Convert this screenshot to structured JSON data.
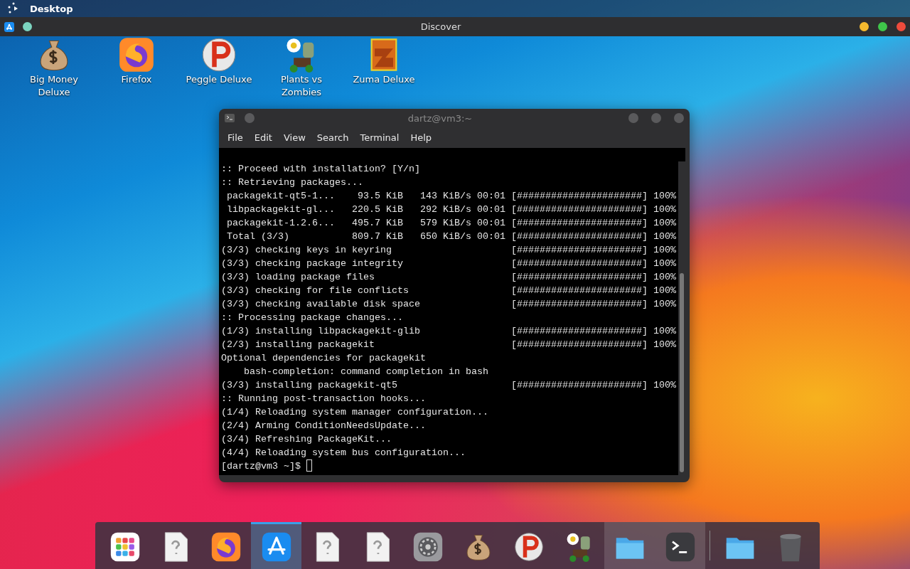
{
  "top_bar": {
    "title": "Desktop"
  },
  "app_bar": {
    "title": "Discover",
    "controls": [
      {
        "kind": "minimize"
      },
      {
        "kind": "maximize"
      },
      {
        "kind": "close"
      }
    ]
  },
  "desktop_icons": [
    {
      "kind": "money",
      "label": "Big Money Deluxe"
    },
    {
      "kind": "firefox",
      "label": "Firefox"
    },
    {
      "kind": "peggle",
      "label": "Peggle Deluxe"
    },
    {
      "kind": "plants",
      "label": "Plants vs Zombies"
    },
    {
      "kind": "zuma",
      "label": "Zuma Deluxe"
    }
  ],
  "terminal": {
    "title": "dartz@vm3:~",
    "menu": [
      "File",
      "Edit",
      "View",
      "Search",
      "Terminal",
      "Help"
    ],
    "lines": [
      {
        "text": ":: Proceed with installation? [Y/n]"
      },
      {
        "text": ":: Retrieving packages..."
      },
      {
        "text": " packagekit-qt5-1...    93.5 KiB   143 KiB/s 00:01",
        "bar": "[######################]",
        "percent": "100%"
      },
      {
        "text": " libpackagekit-gl...   220.5 KiB   292 KiB/s 00:01",
        "bar": "[######################]",
        "percent": "100%"
      },
      {
        "text": " packagekit-1.2.6...   495.7 KiB   579 KiB/s 00:01",
        "bar": "[######################]",
        "percent": "100%"
      },
      {
        "text": " Total (3/3)           809.7 KiB   650 KiB/s 00:01",
        "bar": "[######################]",
        "percent": "100%"
      },
      {
        "text": "(3/3) checking keys in keyring",
        "bar": "[######################]",
        "percent": "100%"
      },
      {
        "text": "(3/3) checking package integrity",
        "bar": "[######################]",
        "percent": "100%"
      },
      {
        "text": "(3/3) loading package files",
        "bar": "[######################]",
        "percent": "100%"
      },
      {
        "text": "(3/3) checking for file conflicts",
        "bar": "[######################]",
        "percent": "100%"
      },
      {
        "text": "(3/3) checking available disk space",
        "bar": "[######################]",
        "percent": "100%"
      },
      {
        "text": ":: Processing package changes..."
      },
      {
        "text": "(1/3) installing libpackagekit-glib",
        "bar": "[######################]",
        "percent": "100%"
      },
      {
        "text": "(2/3) installing packagekit",
        "bar": "[######################]",
        "percent": "100%"
      },
      {
        "text": "Optional dependencies for packagekit"
      },
      {
        "text": "    bash-completion: command completion in bash"
      },
      {
        "text": "(3/3) installing packagekit-qt5",
        "bar": "[######################]",
        "percent": "100%"
      },
      {
        "text": ":: Running post-transaction hooks..."
      },
      {
        "text": "(1/4) Reloading system manager configuration..."
      },
      {
        "text": "(2/4) Arming ConditionNeedsUpdate..."
      },
      {
        "text": "(3/4) Refreshing PackageKit..."
      },
      {
        "text": "(4/4) Reloading system bus configuration..."
      }
    ],
    "prompt": "[dartz@vm3 ~]$"
  },
  "dock": {
    "apps": [
      {
        "kind": "apps",
        "selected": false,
        "open": false
      },
      {
        "kind": "unknown",
        "selected": false,
        "open": false
      },
      {
        "kind": "firefox",
        "selected": false,
        "open": false
      },
      {
        "kind": "store",
        "selected": true,
        "open": true
      },
      {
        "kind": "unknown",
        "selected": false,
        "open": false
      },
      {
        "kind": "unknown",
        "selected": false,
        "open": false
      },
      {
        "kind": "settings",
        "selected": false,
        "open": false
      },
      {
        "kind": "money",
        "selected": false,
        "open": false
      },
      {
        "kind": "peggle",
        "selected": false,
        "open": false
      },
      {
        "kind": "plants",
        "selected": false,
        "open": false
      },
      {
        "kind": "folder",
        "selected": false,
        "open": true
      },
      {
        "kind": "terminal",
        "selected": false,
        "open": true
      }
    ],
    "places": [
      {
        "kind": "folder",
        "selected": false,
        "open": false
      },
      {
        "kind": "trash",
        "selected": false,
        "open": false
      }
    ]
  }
}
